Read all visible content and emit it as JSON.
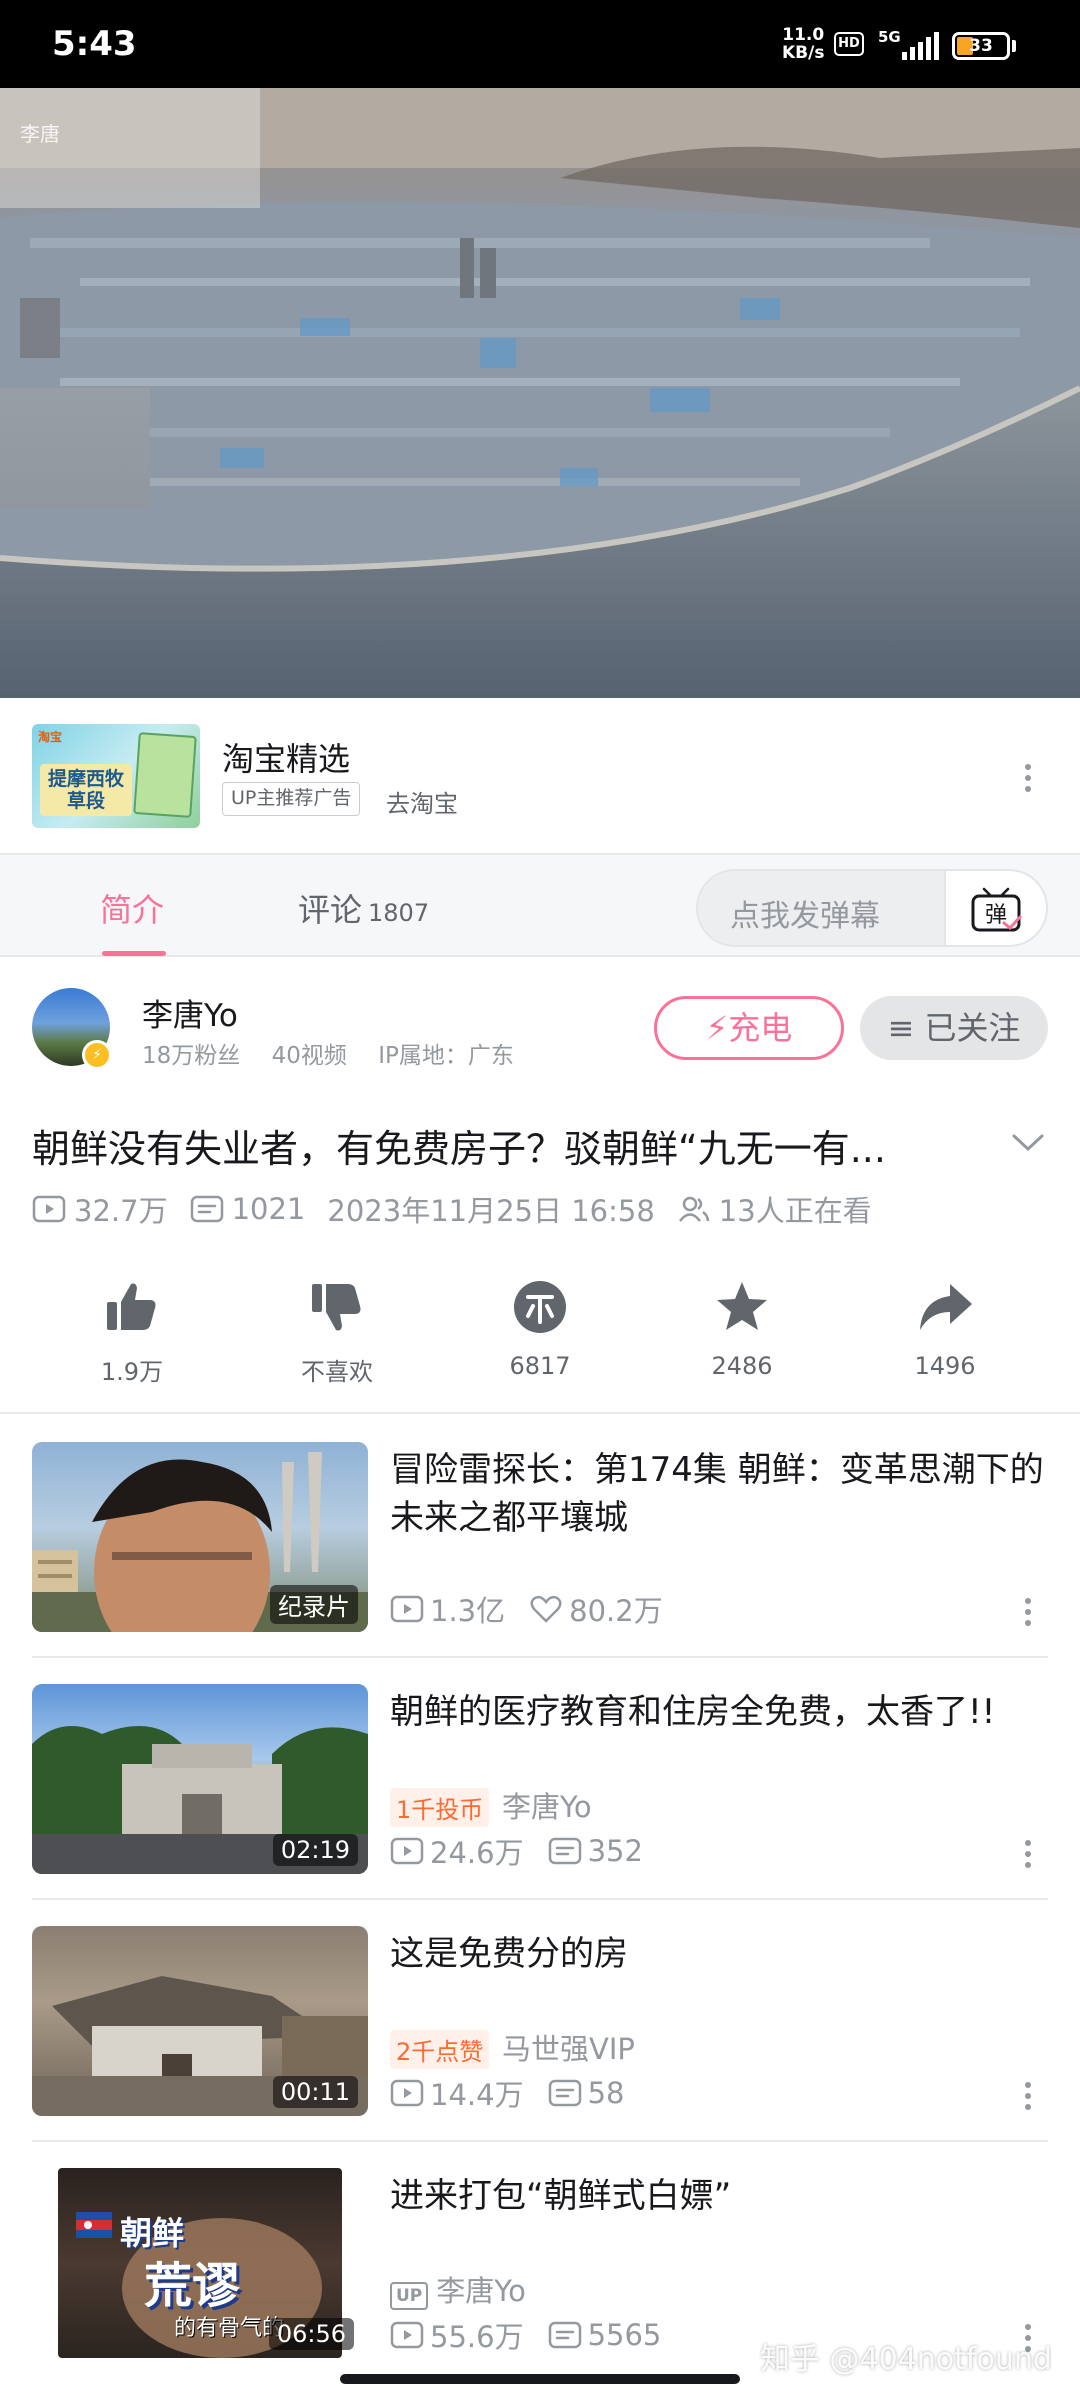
{
  "status_bar": {
    "time": "5:43",
    "net_speed_value": "11.0",
    "net_speed_unit": "KB/s",
    "hd": "HD",
    "network": "5G",
    "battery": "33"
  },
  "video": {
    "watermark": "李唐"
  },
  "ad": {
    "thumb_text": "提摩西牧草段",
    "thumb_tag": "淘宝",
    "title": "淘宝精选",
    "badge": "UP主推荐广告",
    "link": "去淘宝"
  },
  "tabs": {
    "intro": "简介",
    "comments": "评论",
    "comments_count": "1807",
    "danmaku_placeholder": "点我发弹幕",
    "danmaku_icon_char": "弹"
  },
  "uploader": {
    "name": "李唐Yo",
    "fans": "18万粉丝",
    "videos": "40视频",
    "ip": "IP属地：广东",
    "charge_label": "充电",
    "follow_label": "已关注"
  },
  "detail": {
    "title": "朝鲜没有失业者，有免费房子？驳朝鲜“九无一有...",
    "views": "32.7万",
    "danmaku": "1021",
    "date": "2023年11月25日 16:58",
    "watching": "13人正在看"
  },
  "actions": [
    {
      "name": "like",
      "label": "1.9万"
    },
    {
      "name": "dislike",
      "label": "不喜欢"
    },
    {
      "name": "coin",
      "label": "6817"
    },
    {
      "name": "favorite",
      "label": "2486"
    },
    {
      "name": "share",
      "label": "1496"
    }
  ],
  "recommendations": [
    {
      "title": "冒险雷探长：第174集 朝鲜：变革思潮下的未来之都平壤城",
      "badge": "纪录片",
      "views": "1.3亿",
      "likes": "80.2万"
    },
    {
      "title": "朝鲜的医疗教育和住房全免费，太香了!!",
      "duration": "02:19",
      "tag": "1千投币",
      "author": "李唐Yo",
      "views": "24.6万",
      "danmaku": "352"
    },
    {
      "title": "这是免费分的房",
      "duration": "00:11",
      "tag": "2千点赞",
      "author": "马世强VIP",
      "views": "14.4万",
      "danmaku": "58"
    },
    {
      "title": "进来打包“朝鲜式白嫖”",
      "duration": "06:56",
      "up_mark": "UP",
      "author": "李唐Yo",
      "views": "55.6万",
      "danmaku": "5565",
      "thumb_text_1": "朝鲜",
      "thumb_text_2": "荒谬",
      "thumb_text_3": "的有骨气的"
    }
  ],
  "watermark": "知乎 @404notfound",
  "colors": {
    "accent": "#fb7299",
    "secondary_text": "#9499a0",
    "tag_orange": "#ff6a32"
  }
}
